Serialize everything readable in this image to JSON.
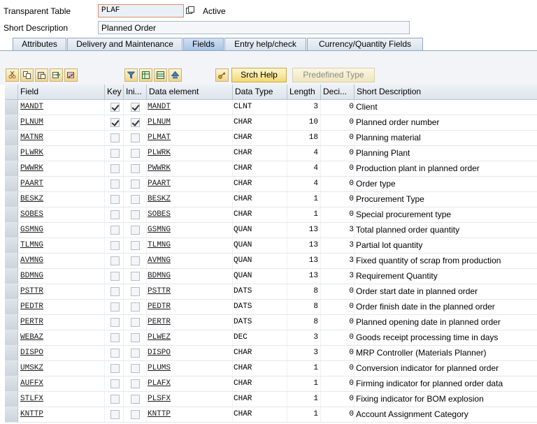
{
  "header": {
    "transparent_table_label": "Transparent Table",
    "table_name": "PLAF",
    "status": "Active",
    "short_description_label": "Short Description",
    "short_description": "Planned Order"
  },
  "tabs": [
    {
      "label": "Attributes"
    },
    {
      "label": "Delivery and Maintenance"
    },
    {
      "label": "Fields"
    },
    {
      "label": "Entry help/check"
    },
    {
      "label": "Currency/Quantity Fields"
    }
  ],
  "active_tab": "Fields",
  "toolbar": {
    "left_icons": [
      "cut-icon",
      "copy-icon",
      "paste-icon",
      "insert-row-icon",
      "delete-row-icon"
    ],
    "mid_icons": [
      "filter-icon",
      "table-icon",
      "table-icon",
      "sort-icon"
    ],
    "key_icon": "key-icon",
    "srch_help_label": "Srch Help",
    "predefined_type_label": "Predefined Type"
  },
  "columns": {
    "field": "Field",
    "key": "Key",
    "initial": "Ini...",
    "data_element": "Data element",
    "data_type": "Data Type",
    "length": "Length",
    "decimals": "Deci...",
    "short_description": "Short Description"
  },
  "rows": [
    {
      "field": "MANDT",
      "key": true,
      "initial": true,
      "data_element": "MANDT",
      "data_type": "CLNT",
      "length": "3",
      "decimals": "0",
      "desc": "Client"
    },
    {
      "field": "PLNUM",
      "key": true,
      "initial": true,
      "data_element": "PLNUM",
      "data_type": "CHAR",
      "length": "10",
      "decimals": "0",
      "desc": "Planned order number"
    },
    {
      "field": "MATNR",
      "key": false,
      "initial": false,
      "data_element": "PLMAT",
      "data_type": "CHAR",
      "length": "18",
      "decimals": "0",
      "desc": "Planning material"
    },
    {
      "field": "PLWRK",
      "key": false,
      "initial": false,
      "data_element": "PLWRK",
      "data_type": "CHAR",
      "length": "4",
      "decimals": "0",
      "desc": "Planning Plant"
    },
    {
      "field": "PWWRK",
      "key": false,
      "initial": false,
      "data_element": "PWWRK",
      "data_type": "CHAR",
      "length": "4",
      "decimals": "0",
      "desc": "Production plant in planned order"
    },
    {
      "field": "PAART",
      "key": false,
      "initial": false,
      "data_element": "PAART",
      "data_type": "CHAR",
      "length": "4",
      "decimals": "0",
      "desc": "Order type"
    },
    {
      "field": "BESKZ",
      "key": false,
      "initial": false,
      "data_element": "BESKZ",
      "data_type": "CHAR",
      "length": "1",
      "decimals": "0",
      "desc": "Procurement Type"
    },
    {
      "field": "SOBES",
      "key": false,
      "initial": false,
      "data_element": "SOBES",
      "data_type": "CHAR",
      "length": "1",
      "decimals": "0",
      "desc": "Special procurement type"
    },
    {
      "field": "GSMNG",
      "key": false,
      "initial": false,
      "data_element": "GSMNG",
      "data_type": "QUAN",
      "length": "13",
      "decimals": "3",
      "desc": "Total planned order quantity"
    },
    {
      "field": "TLMNG",
      "key": false,
      "initial": false,
      "data_element": "TLMNG",
      "data_type": "QUAN",
      "length": "13",
      "decimals": "3",
      "desc": "Partial lot quantity"
    },
    {
      "field": "AVMNG",
      "key": false,
      "initial": false,
      "data_element": "AVMNG",
      "data_type": "QUAN",
      "length": "13",
      "decimals": "3",
      "desc": "Fixed quantity of scrap from production"
    },
    {
      "field": "BDMNG",
      "key": false,
      "initial": false,
      "data_element": "BDMNG",
      "data_type": "QUAN",
      "length": "13",
      "decimals": "3",
      "desc": "Requirement Quantity"
    },
    {
      "field": "PSTTR",
      "key": false,
      "initial": false,
      "data_element": "PSTTR",
      "data_type": "DATS",
      "length": "8",
      "decimals": "0",
      "desc": "Order start date in planned order"
    },
    {
      "field": "PEDTR",
      "key": false,
      "initial": false,
      "data_element": "PEDTR",
      "data_type": "DATS",
      "length": "8",
      "decimals": "0",
      "desc": "Order finish date in the planned order"
    },
    {
      "field": "PERTR",
      "key": false,
      "initial": false,
      "data_element": "PERTR",
      "data_type": "DATS",
      "length": "8",
      "decimals": "0",
      "desc": "Planned opening date in planned order"
    },
    {
      "field": "WEBAZ",
      "key": false,
      "initial": false,
      "data_element": "PLWEZ",
      "data_type": "DEC",
      "length": "3",
      "decimals": "0",
      "desc": "Goods receipt processing time in days"
    },
    {
      "field": "DISPO",
      "key": false,
      "initial": false,
      "data_element": "DISPO",
      "data_type": "CHAR",
      "length": "3",
      "decimals": "0",
      "desc": "MRP Controller (Materials Planner)"
    },
    {
      "field": "UMSKZ",
      "key": false,
      "initial": false,
      "data_element": "PLUMS",
      "data_type": "CHAR",
      "length": "1",
      "decimals": "0",
      "desc": "Conversion indicator for planned order"
    },
    {
      "field": "AUFFX",
      "key": false,
      "initial": false,
      "data_element": "PLAFX",
      "data_type": "CHAR",
      "length": "1",
      "decimals": "0",
      "desc": "Firming indicator for planned order data"
    },
    {
      "field": "STLFX",
      "key": false,
      "initial": false,
      "data_element": "PLSFX",
      "data_type": "CHAR",
      "length": "1",
      "decimals": "0",
      "desc": "Fixing indicator for BOM explosion"
    },
    {
      "field": "KNTTP",
      "key": false,
      "initial": false,
      "data_element": "KNTTP",
      "data_type": "CHAR",
      "length": "1",
      "decimals": "0",
      "desc": "Account Assignment Category"
    }
  ]
}
